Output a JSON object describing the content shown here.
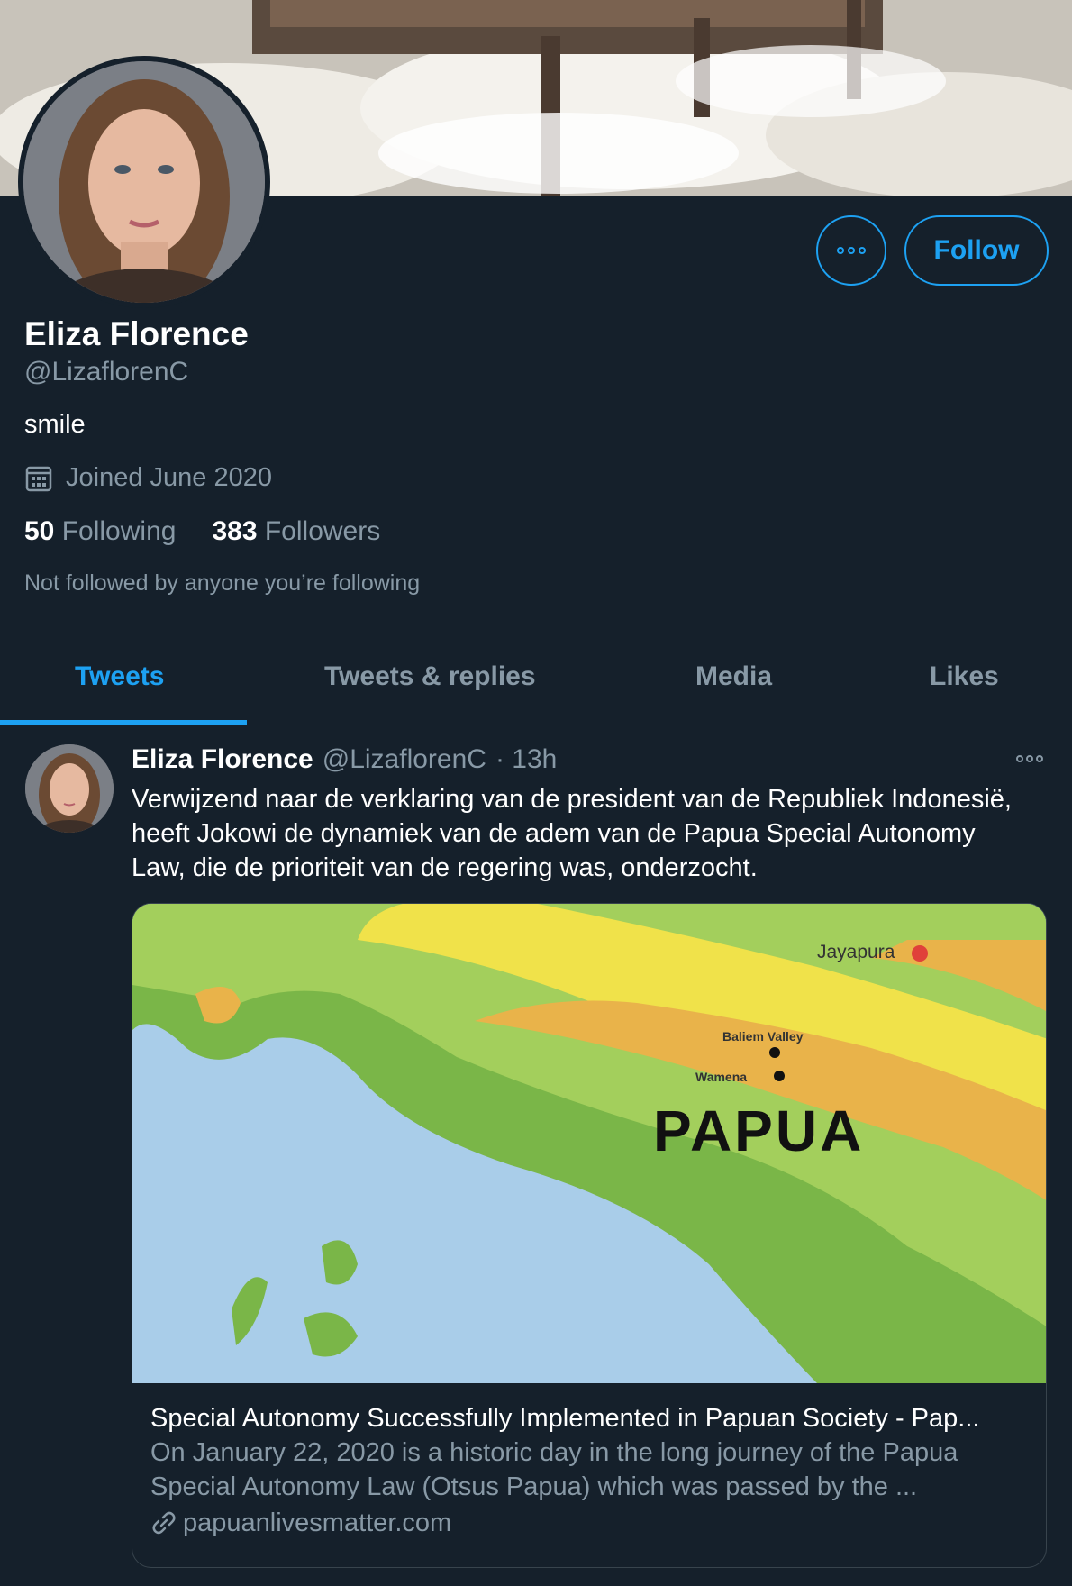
{
  "profile": {
    "name": "Eliza Florence",
    "handle": "@LizaflorenC",
    "bio": "smile",
    "joined": "Joined June 2020",
    "following_count": "50",
    "following_label": "Following",
    "followers_count": "383",
    "followers_label": "Followers",
    "not_followed": "Not followed by anyone you’re following"
  },
  "actions": {
    "follow_label": "Follow"
  },
  "tabs": [
    {
      "label": "Tweets",
      "active": true
    },
    {
      "label": "Tweets & replies",
      "active": false
    },
    {
      "label": "Media",
      "active": false
    },
    {
      "label": "Likes",
      "active": false
    }
  ],
  "tweet": {
    "name": "Eliza Florence",
    "handle": "@LizaflorenC",
    "time": "· 13h",
    "text": "Verwijzend naar de verklaring van de president van de Republiek Indonesië, heeft Jokowi de dynamiek van de adem van de Papua Special Autonomy Law, die de prioriteit van de regering was, onderzocht.",
    "card": {
      "map_labels": {
        "jayapura": "Jayapura",
        "baliem": "Baliem Valley",
        "wamena": "Wamena",
        "papua": "PAPUA"
      },
      "title": "Special Autonomy Successfully Implemented in Papuan Society - Pap...",
      "description": "On January 22, 2020 is a historic day in the long journey of the Papua Special Autonomy Law (Otsus Papua) which was passed by the ...",
      "domain": "papuanlivesmatter.com"
    }
  },
  "colors": {
    "background": "#15202b",
    "accent": "#1da1f2",
    "secondary_text": "#8899a6",
    "border": "#38444d"
  },
  "icons": [
    "more-icon",
    "calendar-icon",
    "link-icon"
  ]
}
